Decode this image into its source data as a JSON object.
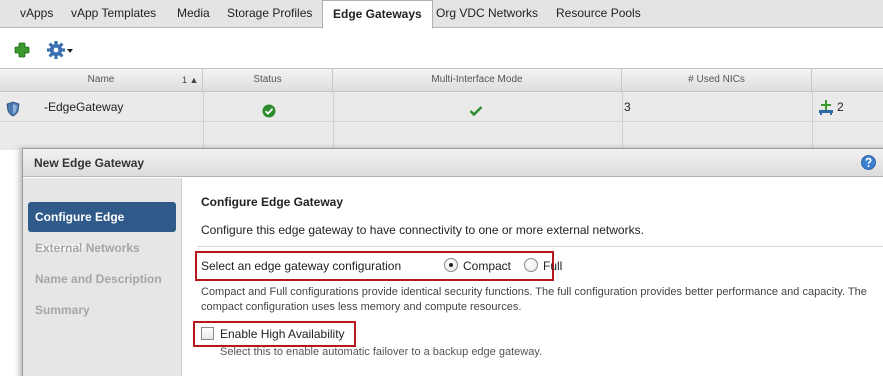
{
  "tabs": [
    {
      "label": "vApps"
    },
    {
      "label": "vApp Templates"
    },
    {
      "label": "Media"
    },
    {
      "label": "Storage Profiles"
    },
    {
      "label": "Edge Gateways",
      "active": true
    },
    {
      "label": "Org VDC Networks"
    },
    {
      "label": "Resource Pools"
    }
  ],
  "toolbar": {
    "add_icon": "plus-icon",
    "actions_icon": "gear-dropdown-icon"
  },
  "grid": {
    "columns": {
      "name": "Name",
      "sort_indicator": "1 ▲",
      "status": "Status",
      "multi_interface": "Multi-Interface Mode",
      "used_nics": "# Used NICs"
    },
    "rows": [
      {
        "name": "-EdgeGateway",
        "status_icon": "green-check-circle-icon",
        "multi_interface_icon": "green-check-icon",
        "used_nics": "3",
        "networks": "2"
      }
    ]
  },
  "dialog": {
    "title": "New Edge Gateway",
    "help_icon": "help-icon",
    "steps": [
      {
        "label": "Configure Edge Gateway",
        "active": true
      },
      {
        "label": "External Networks"
      },
      {
        "label": "Name and Description"
      },
      {
        "label": "Summary"
      }
    ],
    "heading": "Configure Edge Gateway",
    "description": "Configure this edge gateway to have connectivity to one or more external networks.",
    "config_label": "Select an edge gateway configuration",
    "options": {
      "compact": "Compact",
      "full": "Full",
      "selected": "Compact"
    },
    "info_text": "Compact and Full configurations provide identical security functions. The full configuration provides better performance and capacity. The compact configuration uses less memory and compute resources.",
    "ha_label": "Enable High Availability",
    "ha_checked": false,
    "ha_hint": "Select this to enable automatic failover to a backup edge gateway."
  },
  "colors": {
    "active_step": "#2f5a8a",
    "highlight_box": "#b5191c",
    "check_green": "#2e8b2e",
    "add_green": "#3a9b2a",
    "gear_blue": "#3a6fb0"
  }
}
